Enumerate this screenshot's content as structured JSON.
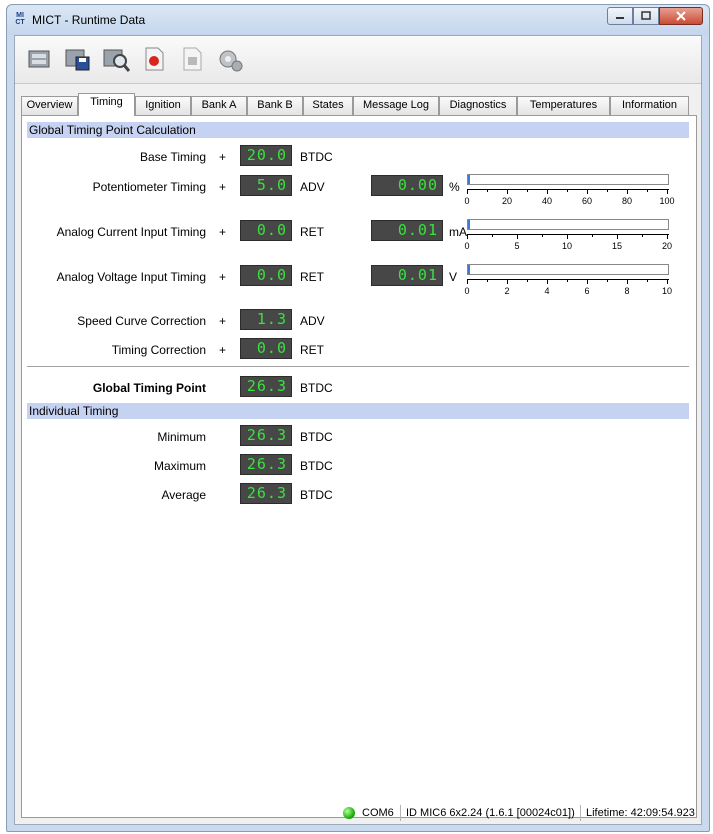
{
  "window": {
    "title": "MICT - Runtime Data",
    "logo_top": "MI",
    "logo_bottom": "CT"
  },
  "toolbar": {
    "buttons": [
      "connect-icon",
      "save-icon",
      "inspect-icon",
      "record-icon",
      "stop-icon",
      "settings-icon"
    ]
  },
  "tabs": [
    {
      "label": "Overview"
    },
    {
      "label": "Timing",
      "active": true
    },
    {
      "label": "Ignition"
    },
    {
      "label": "Bank A"
    },
    {
      "label": "Bank B"
    },
    {
      "label": "States"
    },
    {
      "label": "Message Log"
    },
    {
      "label": "Diagnostics"
    },
    {
      "label": "Temperatures"
    },
    {
      "label": "Information"
    }
  ],
  "global": {
    "header": "Global Timing Point Calculation",
    "plus": "+",
    "base": {
      "label": "Base Timing",
      "value": "20.0",
      "unit": "BTDC"
    },
    "pot": {
      "label": "Potentiometer Timing",
      "value": "5.0",
      "unit": "ADV",
      "input_value": "0.00",
      "input_unit": "%",
      "level": 0.0
    },
    "current": {
      "label": "Analog Current Input Timing",
      "value": "0.0",
      "unit": "RET",
      "input_value": "0.01",
      "input_unit": "mA",
      "level": 0.0005
    },
    "voltage": {
      "label": "Analog Voltage Input Timing",
      "value": "0.0",
      "unit": "RET",
      "input_value": "0.01",
      "input_unit": "V",
      "level": 0.001
    },
    "speed": {
      "label": "Speed Curve Correction",
      "value": "1.3",
      "unit": "ADV"
    },
    "correction": {
      "label": "Timing Correction",
      "value": "0.0",
      "unit": "RET"
    },
    "point": {
      "label": "Global Timing Point",
      "value": "26.3",
      "unit": "BTDC"
    }
  },
  "scales": {
    "percent": [
      "0",
      "20",
      "40",
      "60",
      "80",
      "100"
    ],
    "current": [
      "0",
      "5",
      "10",
      "15",
      "20"
    ],
    "voltage": [
      "0",
      "2",
      "4",
      "6",
      "8",
      "10"
    ]
  },
  "individual": {
    "header": "Individual Timing",
    "minimum": {
      "label": "Minimum",
      "value": "26.3",
      "unit": "BTDC"
    },
    "maximum": {
      "label": "Maximum",
      "value": "26.3",
      "unit": "BTDC"
    },
    "average": {
      "label": "Average",
      "value": "26.3",
      "unit": "BTDC"
    }
  },
  "status": {
    "port": "COM6",
    "device": "ID MIC6 6x2.24 (1.6.1 [00024c01])",
    "lifetime": "Lifetime: 42:09:54.923",
    "led_color": "#1eb30e"
  }
}
